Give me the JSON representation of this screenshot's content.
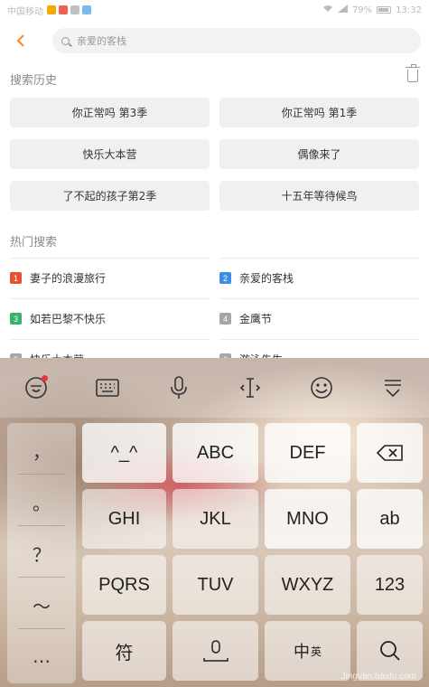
{
  "status_bar": {
    "carrier": "中国移动",
    "battery": "79%",
    "time": "13:32",
    "notif_colors": [
      "#f7a800",
      "#f06050",
      "#c0c0c0",
      "#7fb8ec"
    ]
  },
  "header": {
    "search_placeholder": "亲爱的客栈"
  },
  "history": {
    "title": "搜索历史",
    "items": [
      "你正常吗 第3季",
      "你正常吗 第1季",
      "快乐大本营",
      "偶像来了",
      "了不起的孩子第2季",
      "十五年等待候鸟"
    ]
  },
  "hot": {
    "title": "热门搜索",
    "items": [
      {
        "rank": "1",
        "text": "妻子的浪漫旅行",
        "color": "#e8502e"
      },
      {
        "rank": "2",
        "text": "亲爱的客栈",
        "color": "#3b8fe3"
      },
      {
        "rank": "3",
        "text": "如若巴黎不快乐",
        "color": "#33b36b"
      },
      {
        "rank": "4",
        "text": "金鹰节",
        "color": "#a6a6a6"
      },
      {
        "rank": "5",
        "text": "快乐大本营",
        "color": "#a6a6a6"
      },
      {
        "rank": "6",
        "text": "游泳先生",
        "color": "#a6a6a6"
      }
    ]
  },
  "keyboard": {
    "side_keys": [
      "，",
      "。",
      "？",
      "～",
      "…"
    ],
    "keys": [
      "^_^",
      "ABC",
      "DEF",
      "GHI",
      "JKL",
      "MNO",
      "ab",
      "PQRS",
      "TUV",
      "WXYZ",
      "123",
      "符"
    ],
    "lang_main": "中",
    "lang_alt": "英",
    "toolbar_icons": [
      "ime-logo-icon",
      "keyboard-icon",
      "microphone-icon",
      "cursor-icon",
      "emoji-icon",
      "hide-keyboard-icon"
    ]
  },
  "watermark": "Jingyan.baidu.com"
}
